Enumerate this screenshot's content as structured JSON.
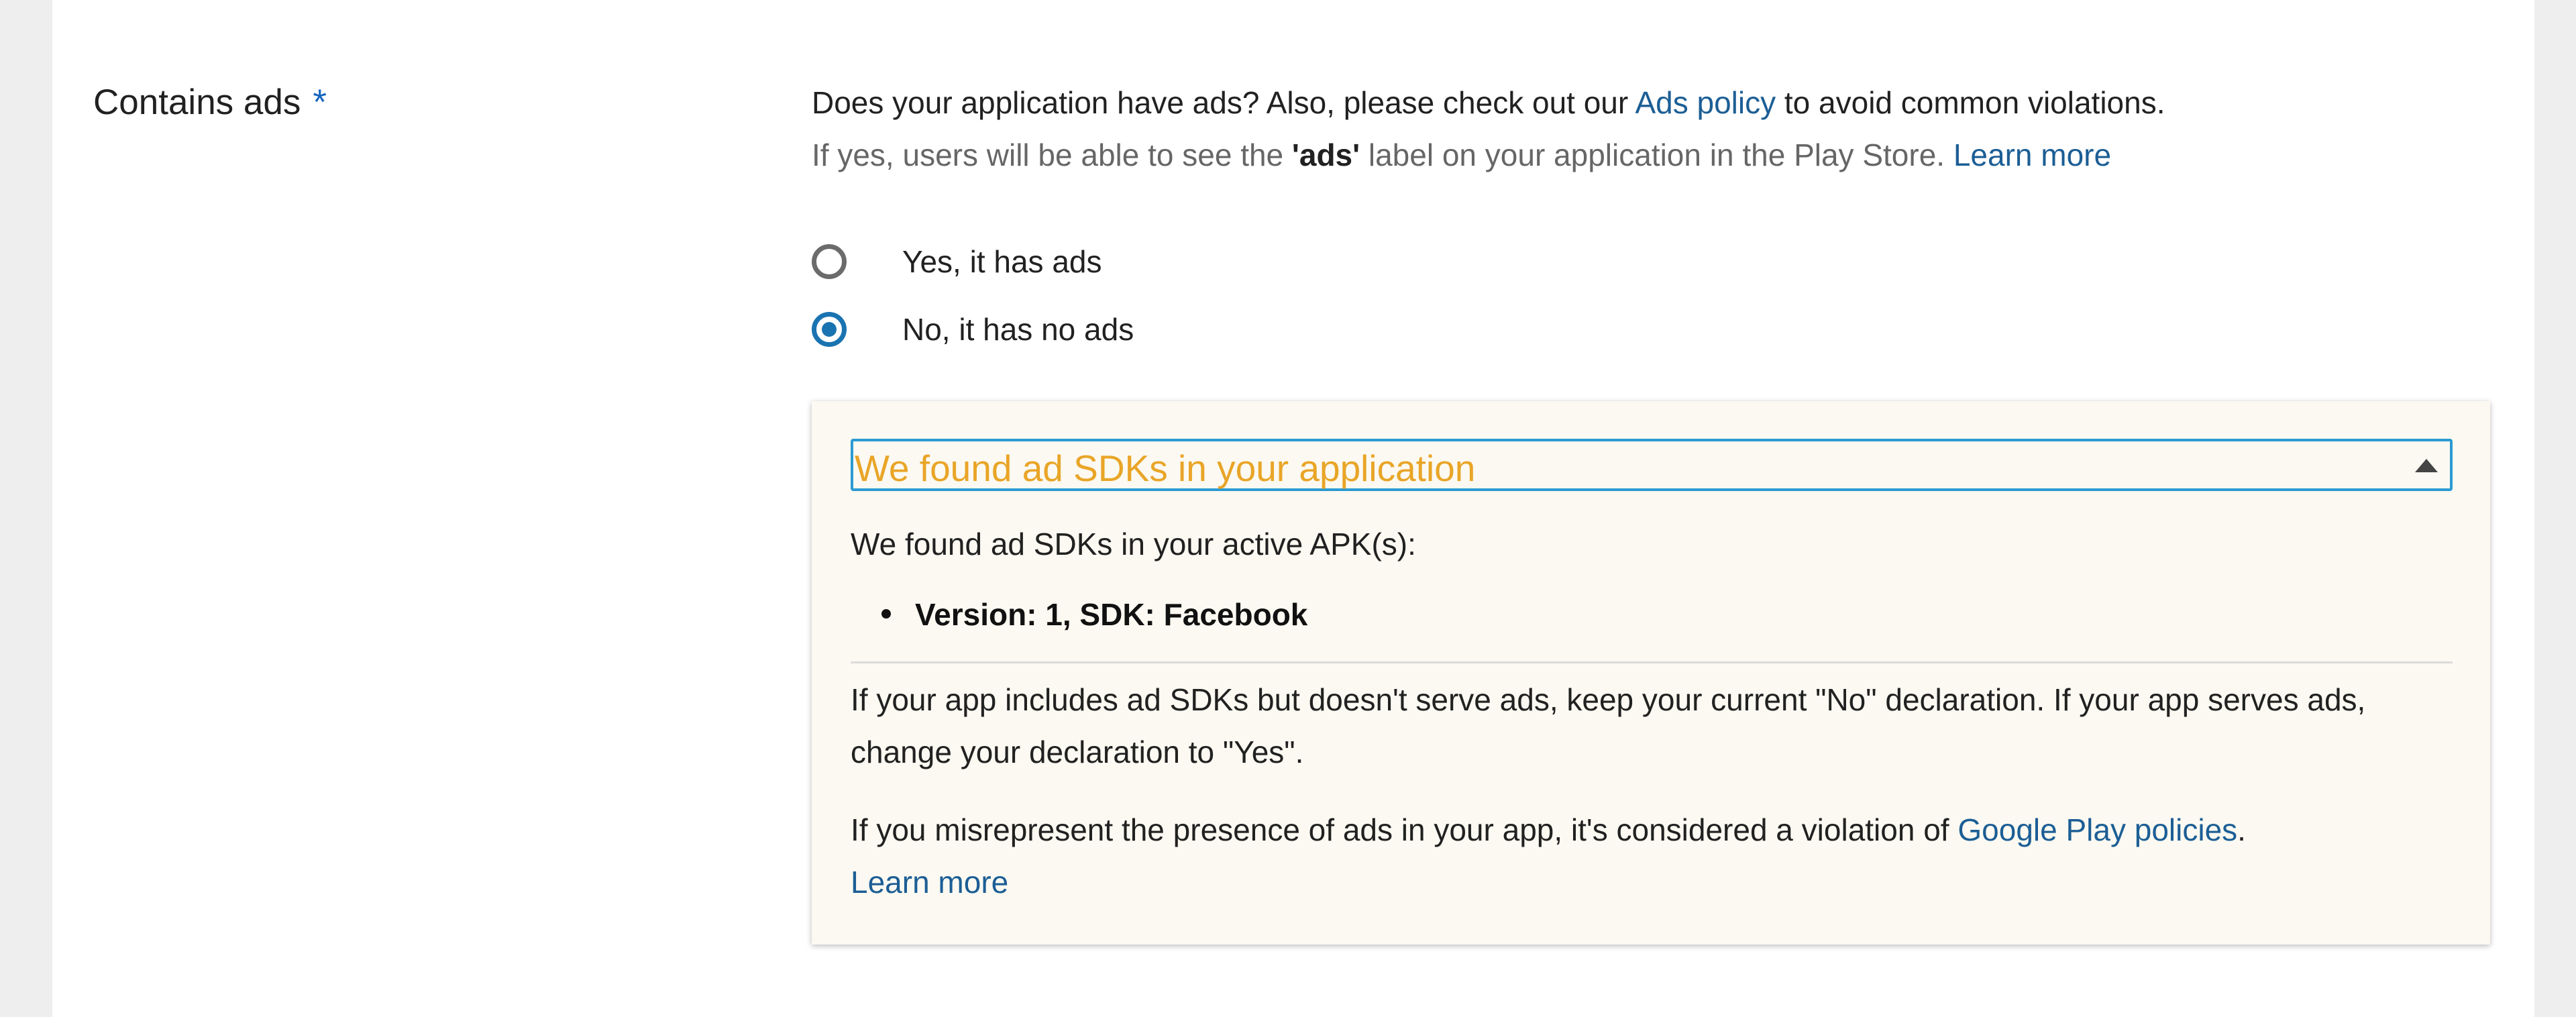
{
  "field": {
    "label": "Contains ads",
    "required_marker": "*"
  },
  "description": {
    "line1_before": "Does your application have ads? Also, please check out our ",
    "line1_link": "Ads policy",
    "line1_after": " to avoid common violations.",
    "line2_before": "If yes, users will be able to see the ",
    "line2_bold": "'ads'",
    "line2_after": " label on your application in the Play Store. ",
    "line2_link": "Learn more"
  },
  "options": [
    {
      "label": "Yes, it has ads",
      "checked": false
    },
    {
      "label": "No, it has no ads",
      "checked": true
    }
  ],
  "notice": {
    "title": "We found ad SDKs in your application",
    "intro": "We found ad SDKs in your active APK(s):",
    "sdks": [
      "Version: 1, SDK: Facebook"
    ],
    "paragraph1": "If your app includes ad SDKs but doesn't serve ads, keep your current \"No\" declaration. If your app serves ads, change your declaration to \"Yes\".",
    "paragraph2_before": "If you misrepresent the presence of ads in your app, it's considered a violation of ",
    "paragraph2_link": "Google Play policies",
    "paragraph2_after": ".",
    "learn_more": "Learn more"
  },
  "colors": {
    "link": "#1c5e95",
    "radio_selected": "#1a73b1",
    "notice_title": "#e9a527",
    "notice_background": "#fbf9f1",
    "header_border": "#2b9bd3"
  },
  "icons": {
    "collapse": "triangle-up-icon"
  }
}
